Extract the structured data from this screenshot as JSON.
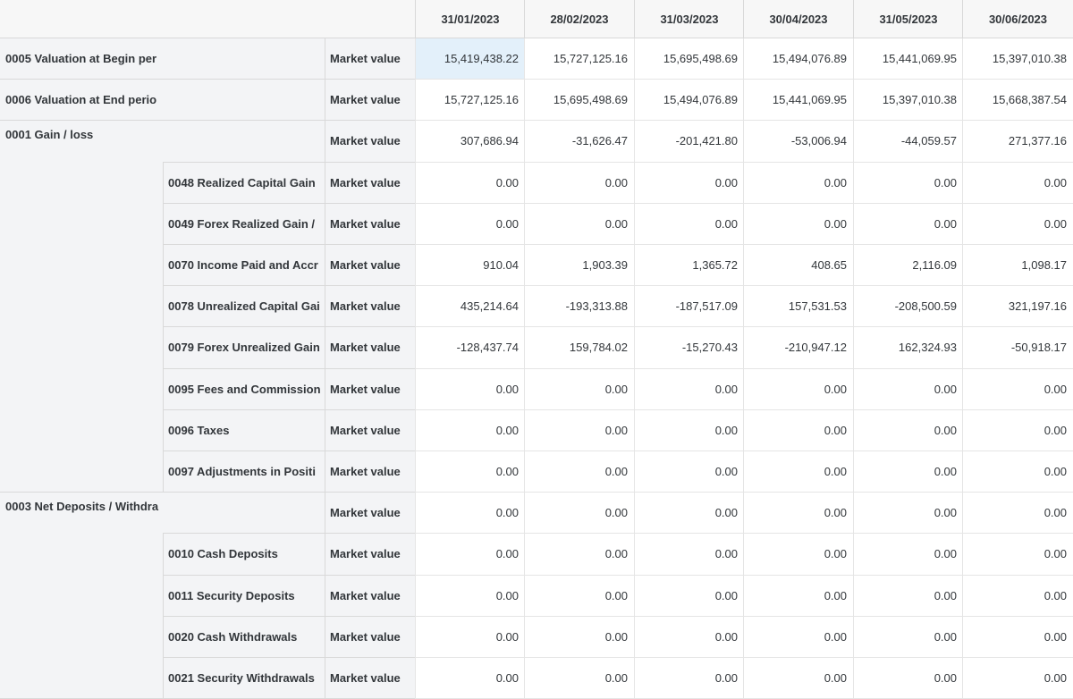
{
  "columns": [
    "31/01/2023",
    "28/02/2023",
    "31/03/2023",
    "30/04/2023",
    "31/05/2023",
    "30/06/2023"
  ],
  "rows": [
    {
      "l1": "0005 Valuation at Begin per",
      "l2": "",
      "measure": "Market value",
      "values": [
        "15,419,438.22",
        "15,727,125.16",
        "15,695,498.69",
        "15,494,076.89",
        "15,441,069.95",
        "15,397,010.38"
      ]
    },
    {
      "l1": "0006 Valuation at End perio",
      "l2": "",
      "measure": "Market value",
      "values": [
        "15,727,125.16",
        "15,695,498.69",
        "15,494,076.89",
        "15,441,069.95",
        "15,397,010.38",
        "15,668,387.54"
      ]
    },
    {
      "l1": "0001 Gain / loss",
      "l2": "",
      "measure": "Market value",
      "values": [
        "307,686.94",
        "-31,626.47",
        "-201,421.80",
        "-53,006.94",
        "-44,059.57",
        "271,377.16"
      ]
    },
    {
      "l1": "",
      "l2": "0048 Realized Capital Gain",
      "measure": "Market value",
      "values": [
        "0.00",
        "0.00",
        "0.00",
        "0.00",
        "0.00",
        "0.00"
      ]
    },
    {
      "l1": "",
      "l2": "0049 Forex Realized Gain /",
      "measure": "Market value",
      "values": [
        "0.00",
        "0.00",
        "0.00",
        "0.00",
        "0.00",
        "0.00"
      ]
    },
    {
      "l1": "",
      "l2": "0070 Income Paid and Accr",
      "measure": "Market value",
      "values": [
        "910.04",
        "1,903.39",
        "1,365.72",
        "408.65",
        "2,116.09",
        "1,098.17"
      ]
    },
    {
      "l1": "",
      "l2": "0078 Unrealized Capital Gai",
      "measure": "Market value",
      "values": [
        "435,214.64",
        "-193,313.88",
        "-187,517.09",
        "157,531.53",
        "-208,500.59",
        "321,197.16"
      ]
    },
    {
      "l1": "",
      "l2": "0079 Forex Unrealized Gain",
      "measure": "Market value",
      "values": [
        "-128,437.74",
        "159,784.02",
        "-15,270.43",
        "-210,947.12",
        "162,324.93",
        "-50,918.17"
      ]
    },
    {
      "l1": "",
      "l2": "0095 Fees and Commission",
      "measure": "Market value",
      "values": [
        "0.00",
        "0.00",
        "0.00",
        "0.00",
        "0.00",
        "0.00"
      ]
    },
    {
      "l1": "",
      "l2": "0096 Taxes",
      "measure": "Market value",
      "values": [
        "0.00",
        "0.00",
        "0.00",
        "0.00",
        "0.00",
        "0.00"
      ]
    },
    {
      "l1": "",
      "l2": "0097 Adjustments in Positi",
      "measure": "Market value",
      "values": [
        "0.00",
        "0.00",
        "0.00",
        "0.00",
        "0.00",
        "0.00"
      ]
    },
    {
      "l1": "0003 Net Deposits / Withdra",
      "l2": "",
      "measure": "Market value",
      "values": [
        "0.00",
        "0.00",
        "0.00",
        "0.00",
        "0.00",
        "0.00"
      ]
    },
    {
      "l1": "",
      "l2": "0010 Cash Deposits",
      "measure": "Market value",
      "values": [
        "0.00",
        "0.00",
        "0.00",
        "0.00",
        "0.00",
        "0.00"
      ]
    },
    {
      "l1": "",
      "l2": "0011 Security Deposits",
      "measure": "Market value",
      "values": [
        "0.00",
        "0.00",
        "0.00",
        "0.00",
        "0.00",
        "0.00"
      ]
    },
    {
      "l1": "",
      "l2": "0020 Cash Withdrawals",
      "measure": "Market value",
      "values": [
        "0.00",
        "0.00",
        "0.00",
        "0.00",
        "0.00",
        "0.00"
      ]
    },
    {
      "l1": "",
      "l2": "0021 Security Withdrawals",
      "measure": "Market value",
      "values": [
        "0.00",
        "0.00",
        "0.00",
        "0.00",
        "0.00",
        "0.00"
      ]
    }
  ]
}
